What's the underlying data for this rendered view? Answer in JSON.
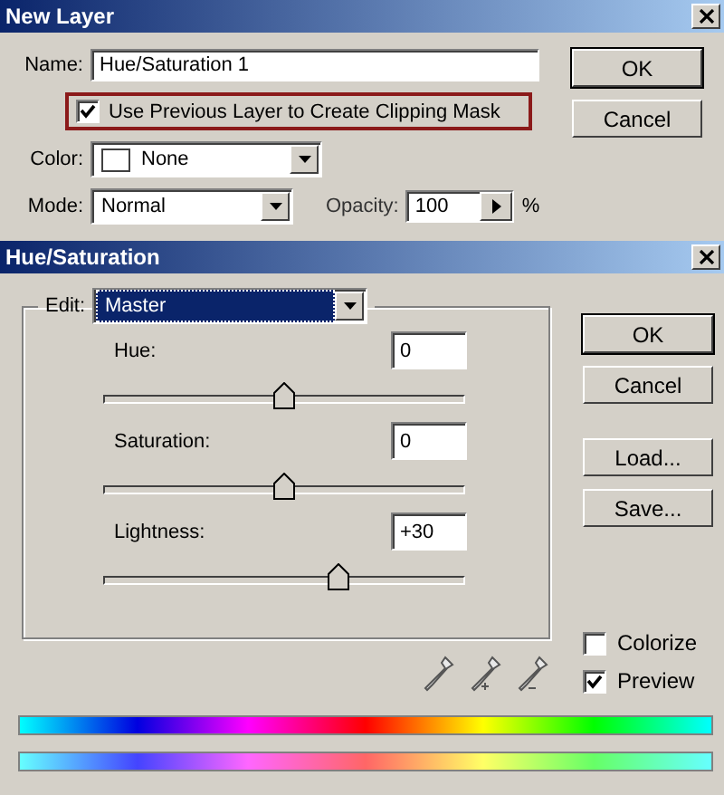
{
  "new_layer": {
    "title": "New Layer",
    "name_label": "Name:",
    "name_value": "Hue/Saturation 1",
    "clipping_mask": {
      "label": "Use Previous Layer to Create Clipping Mask",
      "checked": true
    },
    "color_label": "Color:",
    "color_value": "None",
    "mode_label": "Mode:",
    "mode_value": "Normal",
    "opacity_label": "Opacity:",
    "opacity_value": "100",
    "opacity_unit": "%",
    "buttons": [
      {
        "label": "OK",
        "default": true
      },
      {
        "label": "Cancel",
        "default": false
      }
    ]
  },
  "hue_saturation": {
    "title": "Hue/Saturation",
    "edit_label": "Edit:",
    "edit_value": "Master",
    "sliders": [
      {
        "label": "Hue:",
        "value": "0",
        "level": 0.5
      },
      {
        "label": "Saturation:",
        "value": "0",
        "level": 0.5
      },
      {
        "label": "Lightness:",
        "value": "+30",
        "level": 0.65
      }
    ],
    "buttons": [
      {
        "label": "OK",
        "default": true
      },
      {
        "label": "Cancel",
        "default": false
      },
      {
        "label": "Load...",
        "default": false
      },
      {
        "label": "Save...",
        "default": false
      }
    ],
    "checkboxes": [
      {
        "label": "Colorize",
        "checked": false
      },
      {
        "label": "Preview",
        "checked": true
      }
    ]
  }
}
